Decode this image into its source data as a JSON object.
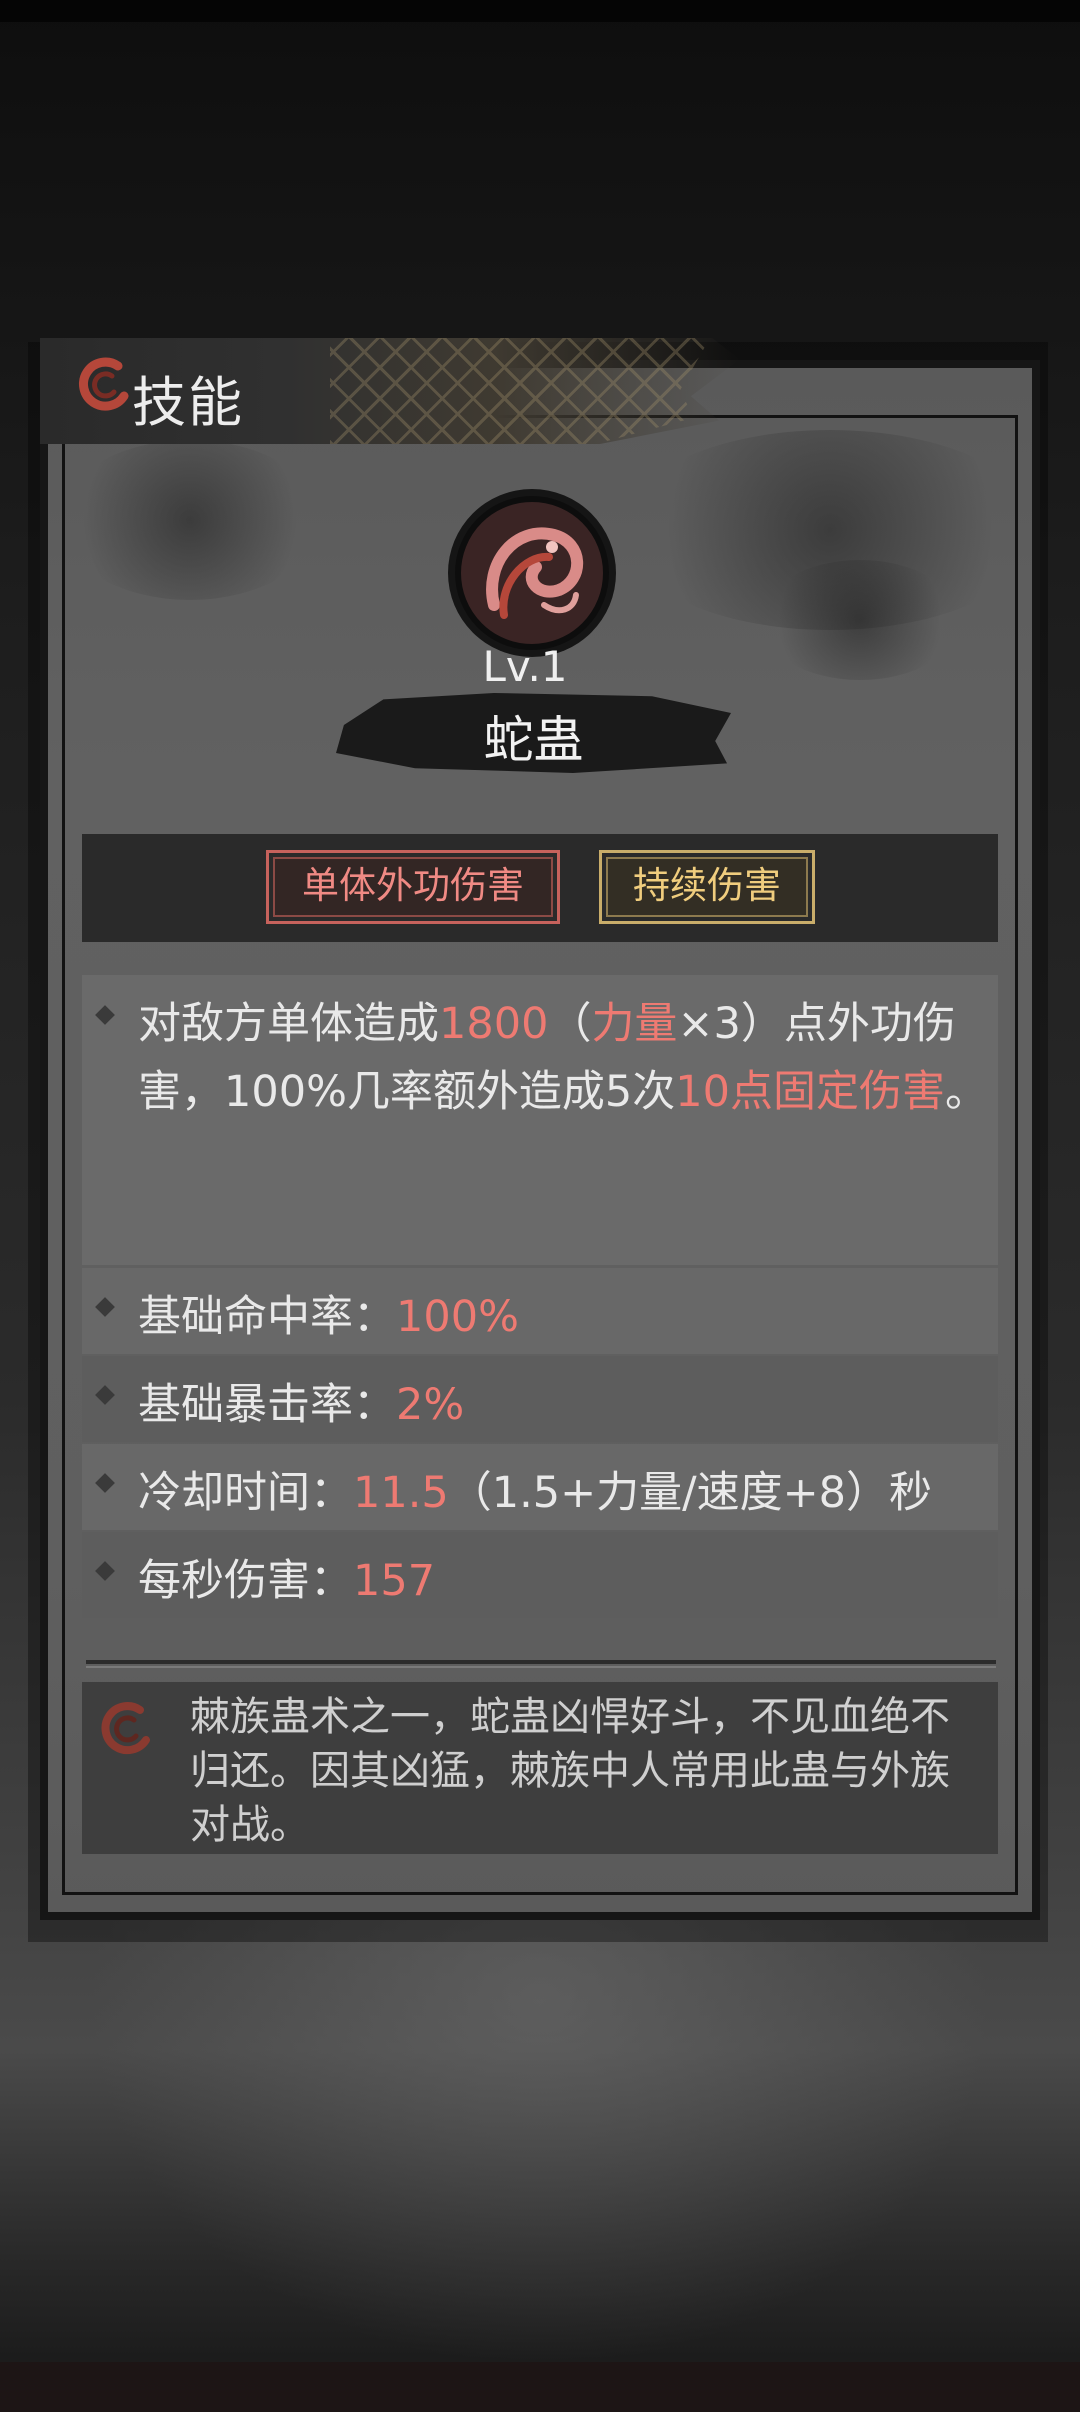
{
  "header": {
    "title": "技能"
  },
  "skill": {
    "icon": "snake-gu-skill-icon",
    "level": "Lv.1",
    "name": "蛇蛊",
    "tags": [
      {
        "label": "单体外功伤害",
        "color": "#c6625c"
      },
      {
        "label": "持续伤害",
        "color": "#c9ad6a"
      }
    ],
    "description": {
      "p1": "对敌方单体造成",
      "v1": "1800",
      "p2": "（",
      "v2": "力量",
      "p3": "×3）点外功伤害，100%几率额外造成5次",
      "v3": "10点固定伤害",
      "p4": "。"
    },
    "stats": [
      {
        "label": "基础命中率：",
        "value": "100%",
        "extra": ""
      },
      {
        "label": "基础暴击率：",
        "value": "2%",
        "extra": ""
      },
      {
        "label": "冷却时间：",
        "value": "11.5",
        "extra": "（1.5+力量/速度+8）秒"
      },
      {
        "label": "每秒伤害：",
        "value": "157",
        "extra": ""
      }
    ],
    "lore": "棘族蛊术之一，蛇蛊凶悍好斗，不见血绝不归还。因其凶猛，棘族中人常用此蛊与外族对战。"
  },
  "colors": {
    "highlight": "#ee7a72",
    "accent_icon": "#b5473a"
  }
}
